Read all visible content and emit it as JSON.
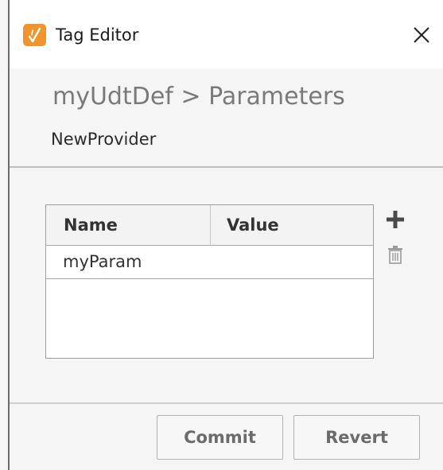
{
  "window": {
    "title": "Tag Editor",
    "accent_color": "#f0942c",
    "icon": "tag-editor-app-icon",
    "close_icon": "close-icon"
  },
  "header": {
    "breadcrumb": "myUdtDef > Parameters",
    "provider": "NewProvider"
  },
  "parameters_table": {
    "columns": [
      "Name",
      "Value"
    ],
    "rows": [
      {
        "name": "myParam",
        "value": ""
      }
    ],
    "add_icon": "plus-icon",
    "delete_icon": "trash-icon"
  },
  "footer": {
    "commit_label": "Commit",
    "revert_label": "Revert"
  }
}
